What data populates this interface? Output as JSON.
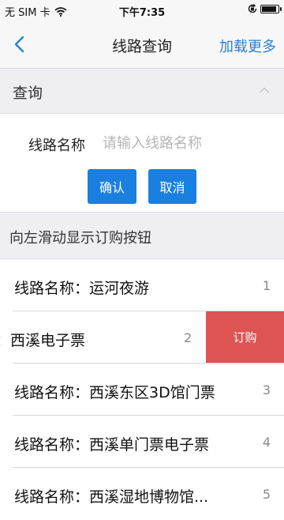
{
  "status_bar": {
    "carrier": "无 SIM 卡",
    "time": "下午7:35"
  },
  "nav": {
    "title": "线路查询",
    "more_label": "加载更多",
    "back_icon": "chevron-left-icon",
    "accent_color": "#2a7fd4"
  },
  "query": {
    "section_title": "查询",
    "field_label": "线路名称",
    "field_placeholder": "请输入线路名称",
    "field_value": "",
    "confirm_label": "确认",
    "cancel_label": "取消",
    "button_color": "#1a7fe0"
  },
  "hint": "向左滑动显示订购按钮",
  "routes": {
    "order_label": "订购",
    "order_color": "#de5453",
    "items": [
      {
        "name": "线路名称：运河夜游",
        "index": "1"
      },
      {
        "name": "：西溪电子票",
        "index": "2"
      },
      {
        "name": "线路名称：西溪东区3D馆门票",
        "index": "3"
      },
      {
        "name": "线路名称：西溪单门票电子票",
        "index": "4"
      },
      {
        "name": "线路名称：西溪湿地博物馆...",
        "index": "5"
      }
    ]
  }
}
